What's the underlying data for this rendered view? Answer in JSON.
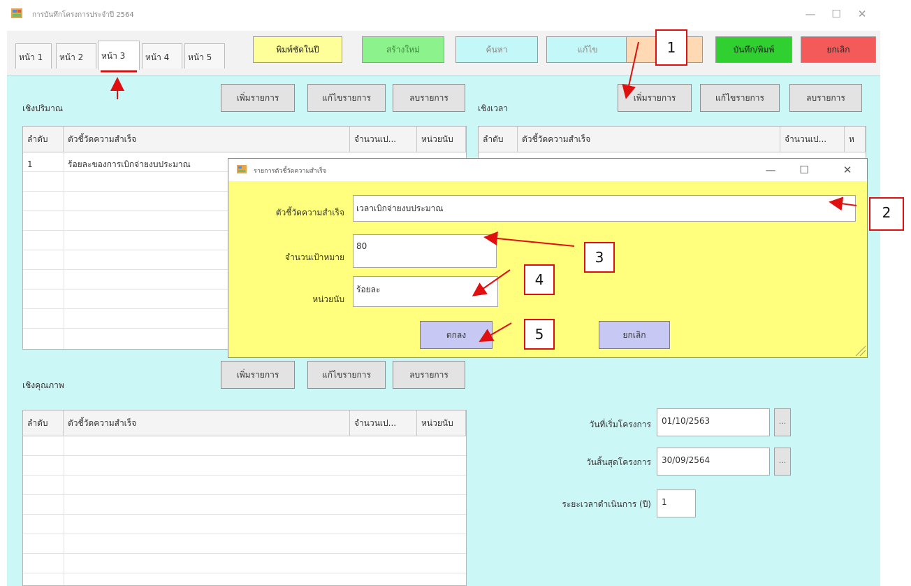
{
  "window": {
    "title": "การบันทึกโครงการประจำปี 2564",
    "minimize_glyph": "—",
    "maximize_glyph": "☐",
    "close_glyph": "✕",
    "icon": "app-form-icon"
  },
  "tabs": [
    {
      "label": "หน้า 1"
    },
    {
      "label": "หน้า 2"
    },
    {
      "label": "หน้า 3"
    },
    {
      "label": "หน้า 4"
    },
    {
      "label": "หน้า 5"
    }
  ],
  "toolbar": {
    "print_year": "พิมพ์ชัดในปี",
    "create_new": "สร้างใหม่",
    "search": "ค้นหา",
    "edit": "แก้ไข",
    "blank": "",
    "save_print": "บันทึก/พิมพ์",
    "cancel": "ยกเลิก"
  },
  "quantity": {
    "title": "เชิงปริมาณ",
    "add": "เพิ่มรายการ",
    "edit": "แก้ไขรายการ",
    "delete": "ลบรายการ",
    "columns": [
      "ลำดับ",
      "ตัวชี้วัดความสำเร็จ",
      "จำนวนเป...",
      "หน่วยนับ"
    ],
    "rows": [
      {
        "no": "1",
        "indicator": "ร้อยละของการเบิกจ่ายงบประมาณ"
      }
    ]
  },
  "time": {
    "title": "เชิงเวลา",
    "add": "เพิ่มรายการ",
    "edit": "แก้ไขรายการ",
    "delete": "ลบรายการ",
    "columns": [
      "ลำดับ",
      "ตัวชี้วัดความสำเร็จ",
      "จำนวนเป...",
      "ห"
    ]
  },
  "quality": {
    "title": "เชิงคุณภาพ",
    "add": "เพิ่มรายการ",
    "edit": "แก้ไขรายการ",
    "delete": "ลบรายการ",
    "columns": [
      "ลำดับ",
      "ตัวชี้วัดความสำเร็จ",
      "จำนวนเป...",
      "หน่วยนับ"
    ]
  },
  "dates": {
    "start_label": "วันที่เริ่มโครงการ",
    "start_value": "01/10/2563",
    "end_label": "วันสิ้นสุดโครงการ",
    "end_value": "30/09/2564",
    "duration_label": "ระยะเวลาดำเนินการ (ปี)",
    "duration_value": "1",
    "picker_glyph": "..."
  },
  "dialog": {
    "title": "รายการตัวชี้วัดความสำเร็จ",
    "indicator_label": "ตัวชี้วัดความสำเร็จ",
    "indicator_value": "เวลาเบิกจ่ายงบประมาณ",
    "target_label": "จำนวนเป้าหมาย",
    "target_value": "80",
    "unit_label": "หน่วยนับ",
    "unit_value": "ร้อยละ",
    "ok": "ตกลง",
    "cancel": "ยกเลิก"
  },
  "annotations": [
    "1",
    "2",
    "3",
    "4",
    "5"
  ],
  "colors": {
    "panel": "#ccf7f7",
    "dialog": "#ffff7d",
    "arrow": "#e01010",
    "btn_print": "#ffff9a",
    "btn_new": "#8cf28c",
    "btn_search": "#c4f7f7",
    "btn_edit": "#c4f7f7",
    "btn_blank": "#ffd9b3",
    "btn_save": "#2fd02f",
    "btn_cancel": "#f55a5a",
    "btn_ok": "#c8c8f4"
  }
}
